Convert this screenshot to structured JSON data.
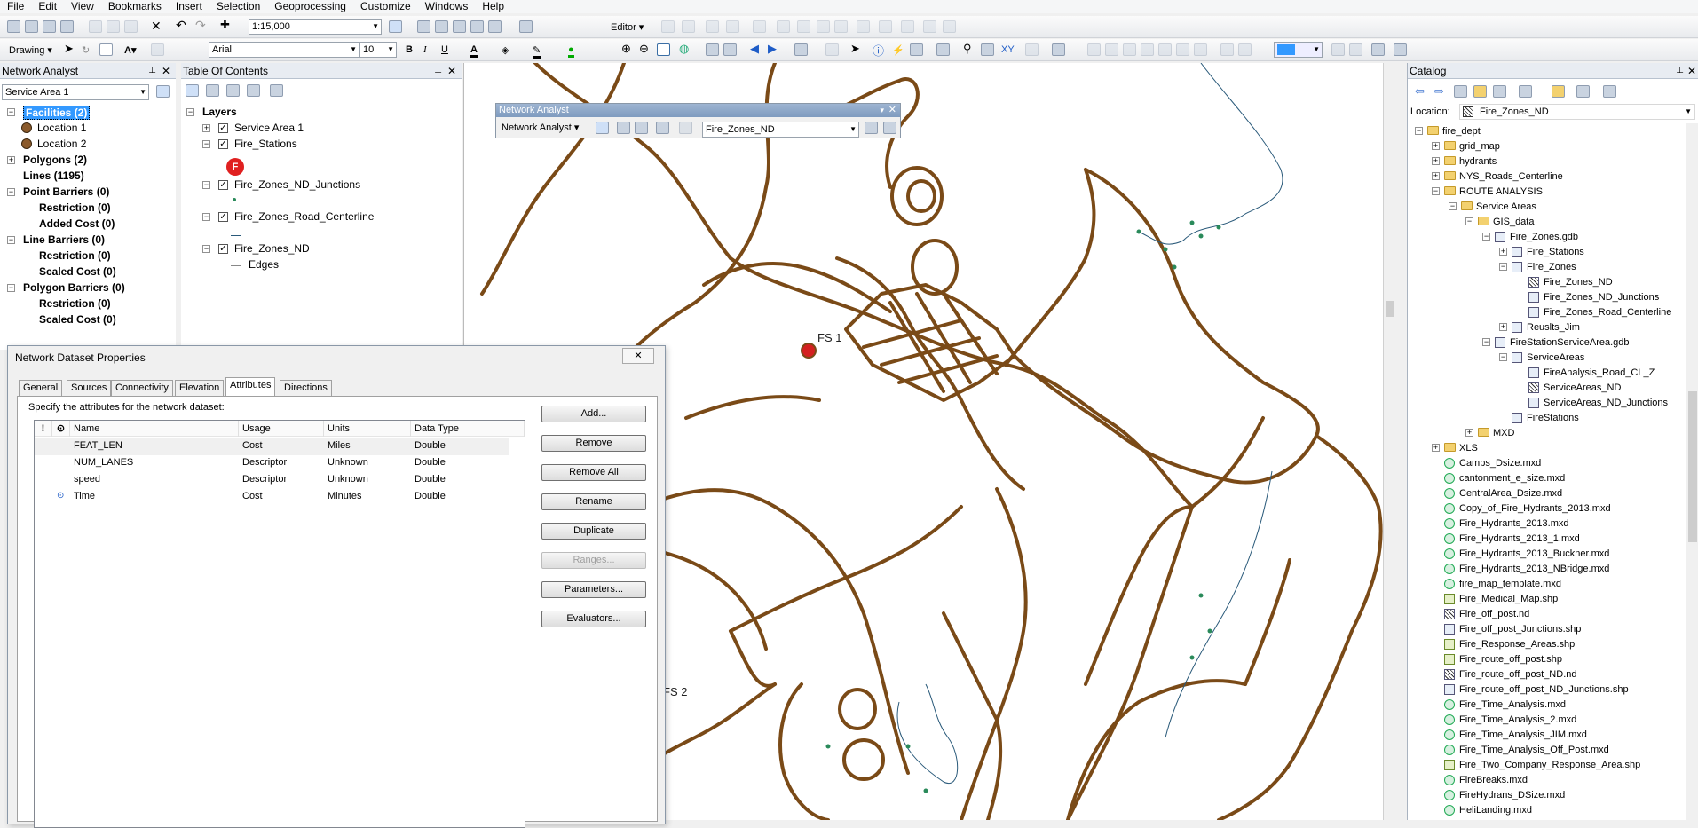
{
  "menu": [
    "File",
    "Edit",
    "View",
    "Bookmarks",
    "Insert",
    "Selection",
    "Geoprocessing",
    "Customize",
    "Windows",
    "Help"
  ],
  "toolbar1": {
    "scale": "1:15,000",
    "editor": "Editor ▾"
  },
  "toolbar2": {
    "drawing": "Drawing ▾",
    "font": "Arial",
    "font_size": "10",
    "bold": "B",
    "italic": "I",
    "underline": "U"
  },
  "network_analyst_window": {
    "title": "Network Analyst",
    "layer": "Service Area 1",
    "items": [
      {
        "label": "Facilities (2)",
        "level": 0,
        "expand": "−",
        "selected": true
      },
      {
        "label": "Location 1",
        "level": 1,
        "dot": true
      },
      {
        "label": "Location 2",
        "level": 1,
        "dot": true
      },
      {
        "label": "Polygons (2)",
        "level": 0,
        "expand": "+"
      },
      {
        "label": "Lines (1195)",
        "level": 0,
        "expand": ""
      },
      {
        "label": "Point Barriers (0)",
        "level": 0,
        "expand": "−"
      },
      {
        "label": "Restriction (0)",
        "level": 1
      },
      {
        "label": "Added Cost (0)",
        "level": 1
      },
      {
        "label": "Line Barriers (0)",
        "level": 0,
        "expand": "−"
      },
      {
        "label": "Restriction (0)",
        "level": 1
      },
      {
        "label": "Scaled Cost (0)",
        "level": 1
      },
      {
        "label": "Polygon Barriers (0)",
        "level": 0,
        "expand": "−"
      },
      {
        "label": "Restriction (0)",
        "level": 1
      },
      {
        "label": "Scaled Cost (0)",
        "level": 1
      }
    ]
  },
  "toc": {
    "title": "Table Of Contents",
    "root": "Layers",
    "layers": [
      {
        "label": "Service Area 1",
        "expand": "+"
      },
      {
        "label": "Fire_Stations",
        "expand": "−"
      },
      {
        "label": "Fire_Zones_ND_Junctions",
        "expand": "−"
      },
      {
        "label": "Fire_Zones_Road_Centerline",
        "expand": "−"
      },
      {
        "label": "Fire_Zones_ND",
        "expand": "−"
      }
    ],
    "legend_edges": "Edges",
    "fire_symbol": "F"
  },
  "na_toolbar": {
    "title": "Network Analyst",
    "menu": "Network Analyst ▾",
    "dataset": "Fire_Zones_ND"
  },
  "map": {
    "labels": [
      "FS 1",
      "FS 2"
    ]
  },
  "dialog": {
    "title": "Network Dataset Properties",
    "tabs": [
      "General",
      "Sources",
      "Connectivity",
      "Elevation",
      "Attributes",
      "Directions"
    ],
    "active_tab": "Attributes",
    "instruction": "Specify the attributes for the network dataset:",
    "columns": [
      "!",
      "⊙",
      "Name",
      "Usage",
      "Units",
      "Data Type"
    ],
    "rows": [
      {
        "flag": "",
        "default": "",
        "name": "FEAT_LEN",
        "usage": "Cost",
        "units": "Miles",
        "type": "Double"
      },
      {
        "flag": "",
        "default": "",
        "name": "NUM_LANES",
        "usage": "Descriptor",
        "units": "Unknown",
        "type": "Double"
      },
      {
        "flag": "",
        "default": "",
        "name": "speed",
        "usage": "Descriptor",
        "units": "Unknown",
        "type": "Double"
      },
      {
        "flag": "",
        "default": "⊙",
        "name": "Time",
        "usage": "Cost",
        "units": "Minutes",
        "type": "Double"
      }
    ],
    "buttons": [
      {
        "label": "Add...",
        "enabled": true
      },
      {
        "label": "Remove",
        "enabled": true
      },
      {
        "label": "Remove All",
        "enabled": true
      },
      {
        "label": "Rename",
        "enabled": true
      },
      {
        "label": "Duplicate",
        "enabled": true
      },
      {
        "label": "Ranges...",
        "enabled": false
      },
      {
        "label": "Parameters...",
        "enabled": true
      },
      {
        "label": "Evaluators...",
        "enabled": true
      }
    ]
  },
  "catalog": {
    "title": "Catalog",
    "location_label": "Location:",
    "location_value": "Fire_Zones_ND",
    "items": [
      {
        "label": "fire_dept",
        "level": 0,
        "expand": "−",
        "icon": "folder"
      },
      {
        "label": "grid_map",
        "level": 1,
        "expand": "+",
        "icon": "folder"
      },
      {
        "label": "hydrants",
        "level": 1,
        "expand": "+",
        "icon": "folder"
      },
      {
        "label": "NYS_Roads_Centerline",
        "level": 1,
        "expand": "+",
        "icon": "folder"
      },
      {
        "label": "ROUTE ANALYSIS",
        "level": 1,
        "expand": "−",
        "icon": "folder"
      },
      {
        "label": "Service Areas",
        "level": 2,
        "expand": "−",
        "icon": "folder"
      },
      {
        "label": "GIS_data",
        "level": 3,
        "expand": "−",
        "icon": "folder"
      },
      {
        "label": "Fire_Zones.gdb",
        "level": 4,
        "expand": "−",
        "icon": "gdb"
      },
      {
        "label": "Fire_Stations",
        "level": 5,
        "expand": "+",
        "icon": "fc"
      },
      {
        "label": "Fire_Zones",
        "level": 5,
        "expand": "−",
        "icon": "fc"
      },
      {
        "label": "Fire_Zones_ND",
        "level": 6,
        "expand": "",
        "icon": "nd"
      },
      {
        "label": "Fire_Zones_ND_Junctions",
        "level": 6,
        "expand": "",
        "icon": "pt"
      },
      {
        "label": "Fire_Zones_Road_Centerline",
        "level": 6,
        "expand": "",
        "icon": "ln"
      },
      {
        "label": "Reuslts_Jim",
        "level": 5,
        "expand": "+",
        "icon": "fc"
      },
      {
        "label": "FireStationServiceArea.gdb",
        "level": 4,
        "expand": "−",
        "icon": "gdb"
      },
      {
        "label": "ServiceAreas",
        "level": 5,
        "expand": "−",
        "icon": "fc"
      },
      {
        "label": "FireAnalysis_Road_CL_Z",
        "level": 6,
        "expand": "",
        "icon": "ln"
      },
      {
        "label": "ServiceAreas_ND",
        "level": 6,
        "expand": "",
        "icon": "nd"
      },
      {
        "label": "ServiceAreas_ND_Junctions",
        "level": 6,
        "expand": "",
        "icon": "pt"
      },
      {
        "label": "FireStations",
        "level": 5,
        "expand": "",
        "icon": "pt"
      },
      {
        "label": "MXD",
        "level": 3,
        "expand": "+",
        "icon": "folder"
      },
      {
        "label": "XLS",
        "level": 1,
        "expand": "+",
        "icon": "folder"
      },
      {
        "label": "Camps_Dsize.mxd",
        "level": 1,
        "expand": "",
        "icon": "mxd"
      },
      {
        "label": "cantonment_e_size.mxd",
        "level": 1,
        "expand": "",
        "icon": "mxd"
      },
      {
        "label": "CentralArea_Dsize.mxd",
        "level": 1,
        "expand": "",
        "icon": "mxd"
      },
      {
        "label": "Copy_of_Fire_Hydrants_2013.mxd",
        "level": 1,
        "expand": "",
        "icon": "mxd"
      },
      {
        "label": "Fire_Hydrants_2013.mxd",
        "level": 1,
        "expand": "",
        "icon": "mxd"
      },
      {
        "label": "Fire_Hydrants_2013_1.mxd",
        "level": 1,
        "expand": "",
        "icon": "mxd"
      },
      {
        "label": "Fire_Hydrants_2013_Buckner.mxd",
        "level": 1,
        "expand": "",
        "icon": "mxd"
      },
      {
        "label": "Fire_Hydrants_2013_NBridge.mxd",
        "level": 1,
        "expand": "",
        "icon": "mxd"
      },
      {
        "label": "fire_map_template.mxd",
        "level": 1,
        "expand": "",
        "icon": "mxd"
      },
      {
        "label": "Fire_Medical_Map.shp",
        "level": 1,
        "expand": "",
        "icon": "shp"
      },
      {
        "label": "Fire_off_post.nd",
        "level": 1,
        "expand": "",
        "icon": "nd"
      },
      {
        "label": "Fire_off_post_Junctions.shp",
        "level": 1,
        "expand": "",
        "icon": "pt"
      },
      {
        "label": "Fire_Response_Areas.shp",
        "level": 1,
        "expand": "",
        "icon": "shp"
      },
      {
        "label": "Fire_route_off_post.shp",
        "level": 1,
        "expand": "",
        "icon": "shp"
      },
      {
        "label": "Fire_route_off_post_ND.nd",
        "level": 1,
        "expand": "",
        "icon": "nd"
      },
      {
        "label": "Fire_route_off_post_ND_Junctions.shp",
        "level": 1,
        "expand": "",
        "icon": "pt"
      },
      {
        "label": "Fire_Time_Analysis.mxd",
        "level": 1,
        "expand": "",
        "icon": "mxd"
      },
      {
        "label": "Fire_Time_Analysis_2.mxd",
        "level": 1,
        "expand": "",
        "icon": "mxd"
      },
      {
        "label": "Fire_Time_Analysis_JIM.mxd",
        "level": 1,
        "expand": "",
        "icon": "mxd"
      },
      {
        "label": "Fire_Time_Analysis_Off_Post.mxd",
        "level": 1,
        "expand": "",
        "icon": "mxd"
      },
      {
        "label": "Fire_Two_Company_Response_Area.shp",
        "level": 1,
        "expand": "",
        "icon": "shp"
      },
      {
        "label": "FireBreaks.mxd",
        "level": 1,
        "expand": "",
        "icon": "mxd"
      },
      {
        "label": "FireHydrans_DSize.mxd",
        "level": 1,
        "expand": "",
        "icon": "mxd"
      },
      {
        "label": "HeliLanding.mxd",
        "level": 1,
        "expand": "",
        "icon": "mxd"
      }
    ]
  },
  "colors": {
    "road": "#7a4a17",
    "station": "#d42020",
    "selection": "#3399ff"
  }
}
